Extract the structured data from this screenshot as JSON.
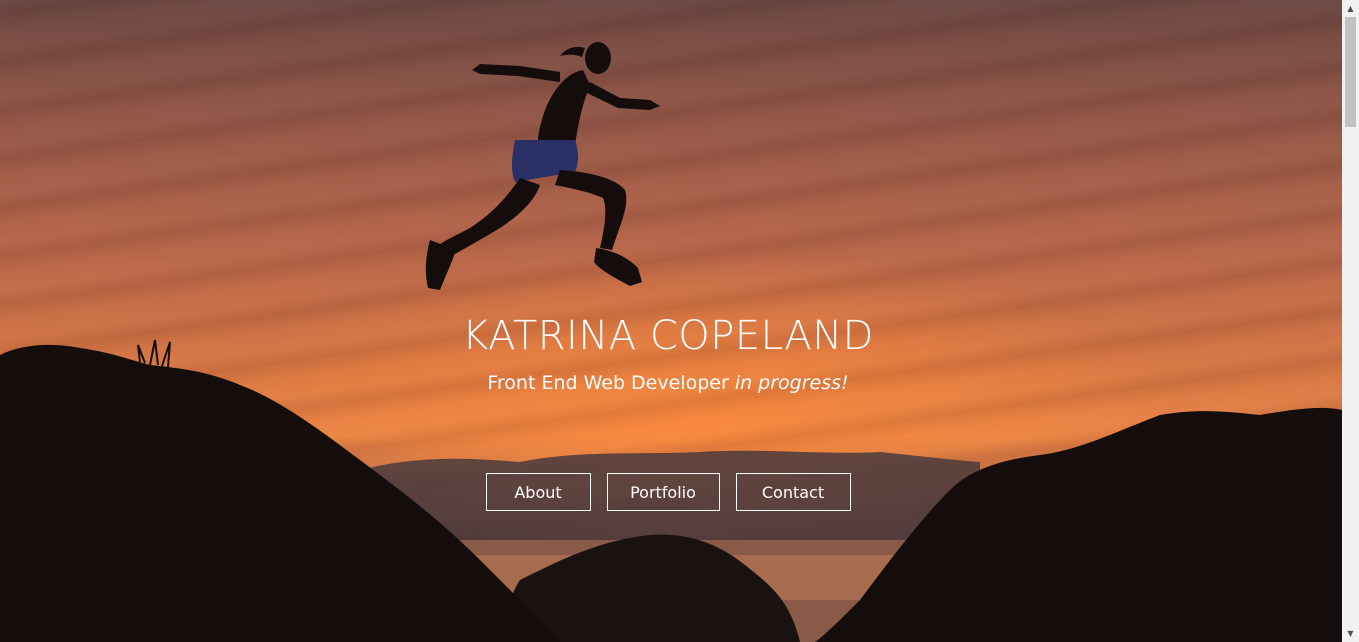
{
  "hero": {
    "title": "KATRINA COPELAND",
    "subtitle_main": "Front End Web Developer ",
    "subtitle_emphasis": "in progress!"
  },
  "nav": {
    "about": "About",
    "portfolio": "Portfolio",
    "contact": "Contact"
  },
  "scrollbar": {
    "up_arrow": "▲",
    "down_arrow": "▼"
  },
  "colors": {
    "text": "#ffffff",
    "sky_orange": "#e8864a",
    "silhouette": "#140d0c",
    "scrollbar_track": "#f1f1f1",
    "scrollbar_thumb": "#c1c1c1"
  }
}
